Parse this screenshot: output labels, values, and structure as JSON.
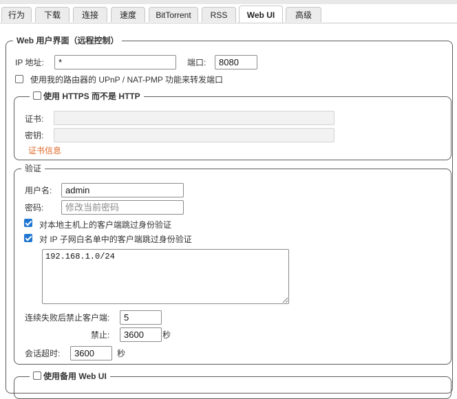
{
  "tabs": [
    {
      "label": "行为"
    },
    {
      "label": "下载"
    },
    {
      "label": "连接"
    },
    {
      "label": "速度"
    },
    {
      "label": "BitTorrent"
    },
    {
      "label": "RSS"
    },
    {
      "label": "Web UI",
      "active": true
    },
    {
      "label": "高级"
    }
  ],
  "webui": {
    "legend": "Web 用户界面（远程控制）",
    "ip_label": "IP 地址:",
    "ip_value": "*",
    "port_label": "端口:",
    "port_value": "8080",
    "upnp_label": "使用我的路由器的 UPnP / NAT-PMP 功能来转发端口",
    "upnp_checked": false
  },
  "https": {
    "legend": "使用 HTTPS 而不是 HTTP",
    "checked": false,
    "cert_label": "证书:",
    "key_label": "密钥:",
    "cert_info_link": "证书信息"
  },
  "auth": {
    "legend": "验证",
    "username_label": "用户名:",
    "username_value": "admin",
    "password_label": "密码:",
    "password_placeholder": "修改当前密码",
    "bypass_local_label": "对本地主机上的客户端跳过身份验证",
    "bypass_local_checked": true,
    "bypass_whitelist_label": "对 IP 子网白名单中的客户端跳过身份验证",
    "bypass_whitelist_checked": true,
    "whitelist_value": "192.168.1.0/24",
    "ban_fail_label": "连续失败后禁止客户端:",
    "ban_fail_value": "5",
    "ban_for_label": "禁止:",
    "ban_for_value": "3600",
    "ban_for_unit": "秒",
    "session_timeout_label": "会话超时:",
    "session_timeout_value": "3600",
    "session_timeout_unit": "秒"
  },
  "alt_webui": {
    "legend": "使用备用 Web UI",
    "checked": false
  },
  "colors": {
    "accent": "#1f76d2",
    "link": "#e06a2a",
    "border": "#5a5a5a"
  }
}
